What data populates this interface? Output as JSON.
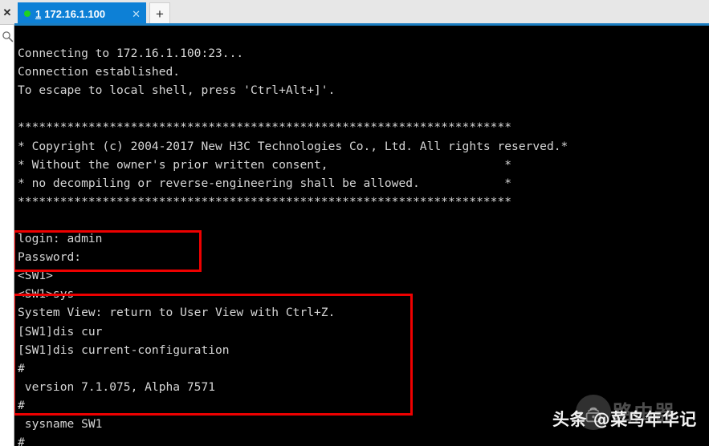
{
  "window": {
    "rail": {
      "close_icon": "close-icon",
      "search_icon": "search-icon",
      "close_glyph": "✕"
    }
  },
  "tabbar": {
    "new_tab_label": "+",
    "tabs": [
      {
        "index": "1",
        "title": "172.16.1.100",
        "close_glyph": "✕",
        "status": "connected",
        "status_color": "#1fd321",
        "active": true,
        "bg_color": "#0d80d6"
      }
    ]
  },
  "terminal": {
    "foreground": "#d6d6d6",
    "background": "#000000",
    "lines": [
      "",
      "Connecting to 172.16.1.100:23...",
      "Connection established.",
      "To escape to local shell, press 'Ctrl+Alt+]'.",
      "",
      "**********************************************************************",
      "* Copyright (c) 2004-2017 New H3C Technologies Co., Ltd. All rights reserved.*",
      "* Without the owner's prior written consent,                         *",
      "* no decompiling or reverse-engineering shall be allowed.            *",
      "**********************************************************************",
      "",
      "login: admin",
      "Password:",
      "<SW1>",
      "<SW1>sys",
      "System View: return to User View with Ctrl+Z.",
      "[SW1]dis cur",
      "[SW1]dis current-configuration",
      "#",
      " version 7.1.075, Alpha 7571",
      "#",
      " sysname SW1",
      "#"
    ]
  },
  "annotations": {
    "color": "#ee0000",
    "boxes": [
      {
        "name": "login-credentials-highlight",
        "covers": "login: admin / Password:"
      },
      {
        "name": "system-config-highlight",
        "covers": "<SW1>sys through #"
      }
    ]
  },
  "watermarks": {
    "faded": {
      "text": "路由器",
      "icon": "router-wifi-icon"
    },
    "main": {
      "text": "头条 @菜鸟年华记"
    }
  }
}
